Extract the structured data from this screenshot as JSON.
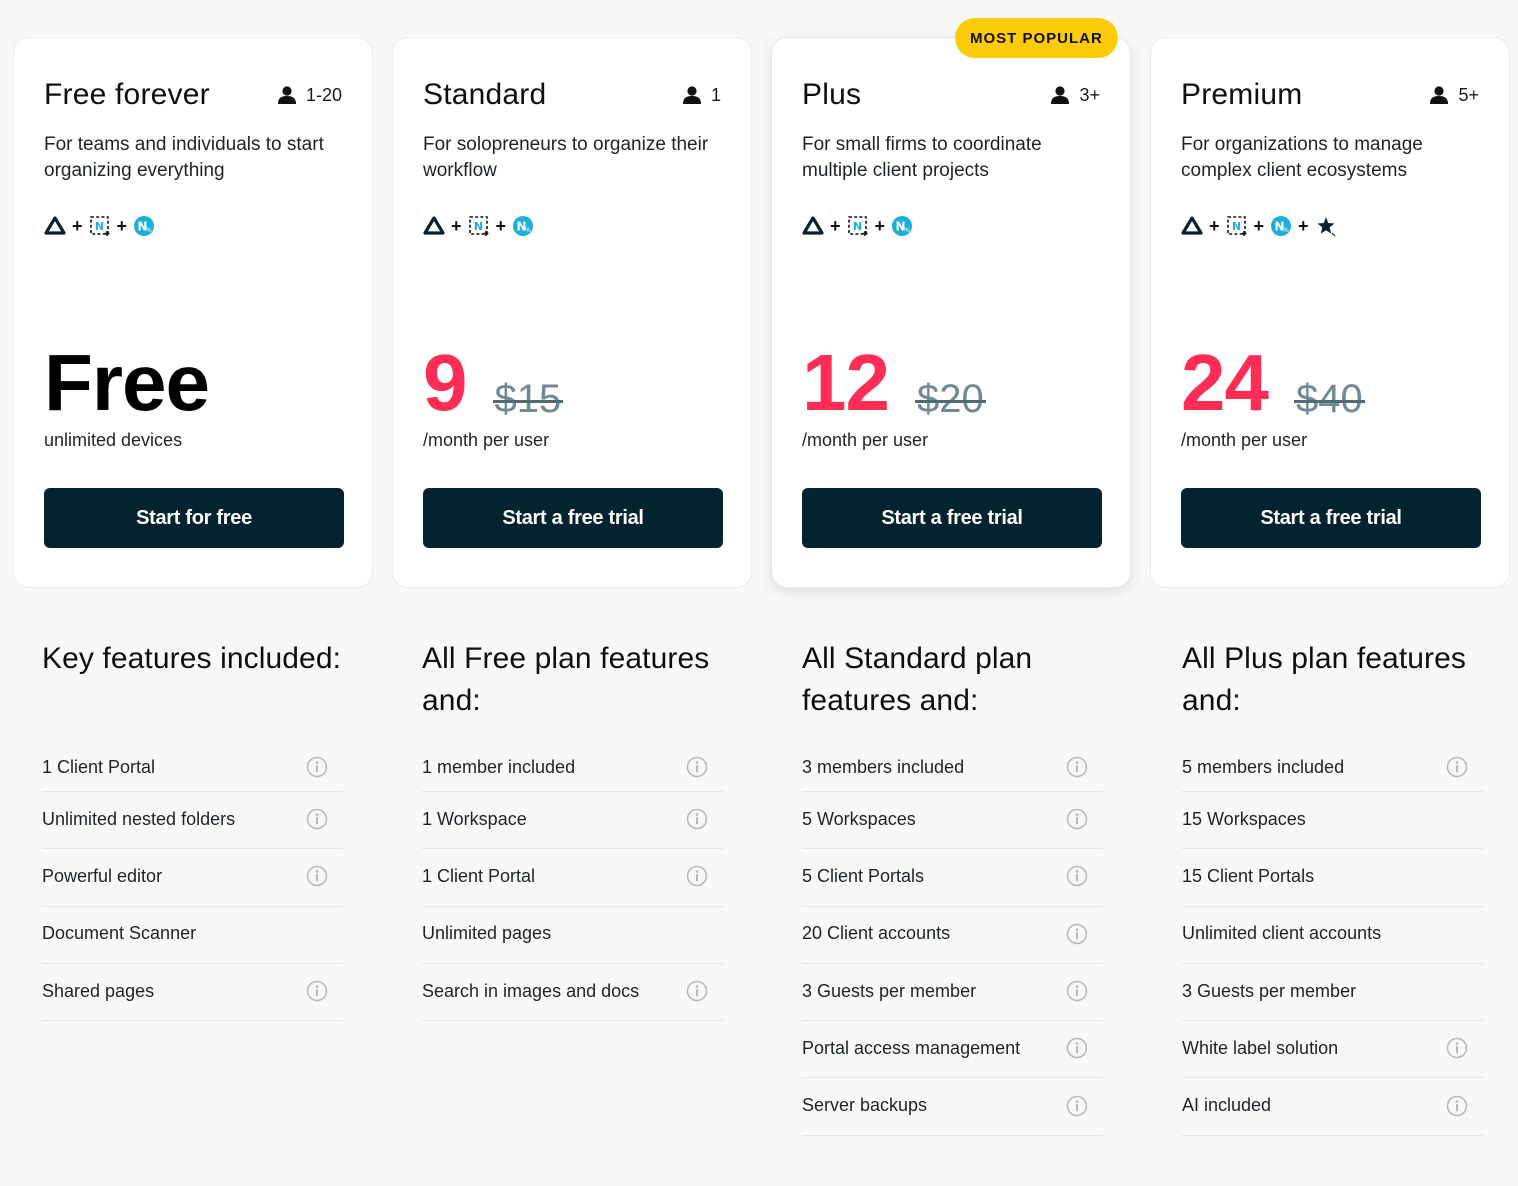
{
  "badge": "MOST POPULAR",
  "colors": {
    "accent_price": "#ff2d55",
    "cta_bg": "#03232e",
    "badge_bg": "#fdcb08",
    "old_price": "#6f8a95"
  },
  "plans": [
    {
      "name": "Free forever",
      "seats": "1-20",
      "seats_icon": "user-icon",
      "description": "For teams and individuals to start organizing everything",
      "apps": [
        "app-triangle-icon",
        "app-scanner-icon",
        "app-notes-icon"
      ],
      "price": "Free",
      "old_price": "",
      "price_sub": "unlimited devices",
      "cta": "Start for free"
    },
    {
      "name": "Standard",
      "seats": "1",
      "seats_icon": "user-icon",
      "description": "For solopreneurs to organize their workflow",
      "apps": [
        "app-triangle-icon",
        "app-scanner-icon",
        "app-notes-icon"
      ],
      "price": "9",
      "old_price": "$15",
      "price_sub": "/month per user",
      "cta": "Start a free trial"
    },
    {
      "name": "Plus",
      "seats": "3+",
      "seats_icon": "user-icon",
      "description": "For small firms to coordinate multiple client projects",
      "apps": [
        "app-triangle-icon",
        "app-scanner-icon",
        "app-notes-icon"
      ],
      "price": "12",
      "old_price": "$20",
      "price_sub": "/month per user",
      "cta": "Start a free trial",
      "popular": true
    },
    {
      "name": "Premium",
      "seats": "5+",
      "seats_icon": "user-icon",
      "description": "For organizations to manage complex client ecosystems",
      "apps": [
        "app-triangle-icon",
        "app-scanner-icon",
        "app-notes-icon",
        "app-ai-star-icon"
      ],
      "price": "24",
      "old_price": "$40",
      "price_sub": "/month per user",
      "cta": "Start a free trial"
    }
  ],
  "feature_columns": [
    {
      "title": "Key features included:",
      "items": [
        {
          "label": "1 Client Portal",
          "info": true
        },
        {
          "label": "Unlimited nested folders",
          "info": true
        },
        {
          "label": "Powerful editor",
          "info": true
        },
        {
          "label": "Document Scanner",
          "info": false
        },
        {
          "label": "Shared pages",
          "info": true
        }
      ]
    },
    {
      "title": "All Free plan features and:",
      "items": [
        {
          "label": "1 member included",
          "info": true
        },
        {
          "label": "1 Workspace",
          "info": true
        },
        {
          "label": "1 Client Portal",
          "info": true
        },
        {
          "label": "Unlimited pages",
          "info": false
        },
        {
          "label": "Search in images and docs",
          "info": true
        }
      ]
    },
    {
      "title": "All Standard plan features and:",
      "items": [
        {
          "label": "3 members included",
          "info": true
        },
        {
          "label": "5 Workspaces",
          "info": true
        },
        {
          "label": "5 Client Portals",
          "info": true
        },
        {
          "label": "20 Client accounts",
          "info": true
        },
        {
          "label": "3 Guests per member",
          "info": true
        },
        {
          "label": "Portal access management",
          "info": true
        },
        {
          "label": "Server backups",
          "info": true
        }
      ]
    },
    {
      "title": "All Plus plan features and:",
      "items": [
        {
          "label": "5 members included",
          "info": true
        },
        {
          "label": "15 Workspaces",
          "info": false
        },
        {
          "label": "15 Client Portals",
          "info": false
        },
        {
          "label": "Unlimited client accounts",
          "info": false
        },
        {
          "label": "3 Guests per member",
          "info": false
        },
        {
          "label": "White label solution",
          "info": true
        },
        {
          "label": "AI included",
          "info": true
        }
      ]
    }
  ]
}
